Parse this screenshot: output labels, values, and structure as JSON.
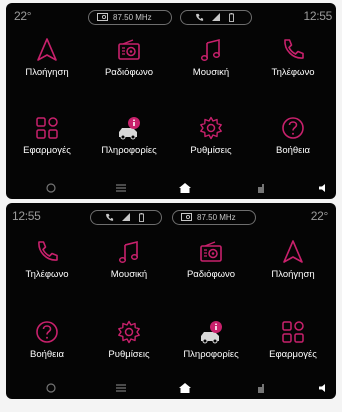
{
  "top": {
    "status": {
      "left_text": "22°",
      "pill_left_frequency": "87.50 MHz",
      "right_text": "12:55"
    },
    "tiles": [
      {
        "label": "Πλοήγηση",
        "icon": "navigation-icon"
      },
      {
        "label": "Ραδιόφωνο",
        "icon": "radio-icon"
      },
      {
        "label": "Μουσική",
        "icon": "music-icon"
      },
      {
        "label": "Τηλέφωνο",
        "icon": "phone-icon"
      },
      {
        "label": "Εφαρμογές",
        "icon": "apps-icon"
      },
      {
        "label": "Πληροφορίες",
        "icon": "info-car-icon"
      },
      {
        "label": "Ρυθμίσεις",
        "icon": "settings-icon"
      },
      {
        "label": "Βοήθεια",
        "icon": "help-icon"
      }
    ]
  },
  "bottom": {
    "status": {
      "left_text": "12:55",
      "pill_right_frequency": "87.50 MHz",
      "right_text": "22°"
    },
    "tiles": [
      {
        "label": "Τηλέφωνο",
        "icon": "phone-icon"
      },
      {
        "label": "Μουσική",
        "icon": "music-icon"
      },
      {
        "label": "Ραδιόφωνο",
        "icon": "radio-icon"
      },
      {
        "label": "Πλοήγηση",
        "icon": "navigation-icon"
      },
      {
        "label": "Βοήθεια",
        "icon": "help-icon"
      },
      {
        "label": "Ρυθμίσεις",
        "icon": "settings-icon"
      },
      {
        "label": "Πληροφορίες",
        "icon": "info-car-icon"
      },
      {
        "label": "Εφαρμογές",
        "icon": "apps-icon"
      }
    ]
  },
  "colors": {
    "accent": "#c8216c",
    "background": "#050505",
    "label": "#ffffff",
    "status_text": "#9c9c9c"
  }
}
